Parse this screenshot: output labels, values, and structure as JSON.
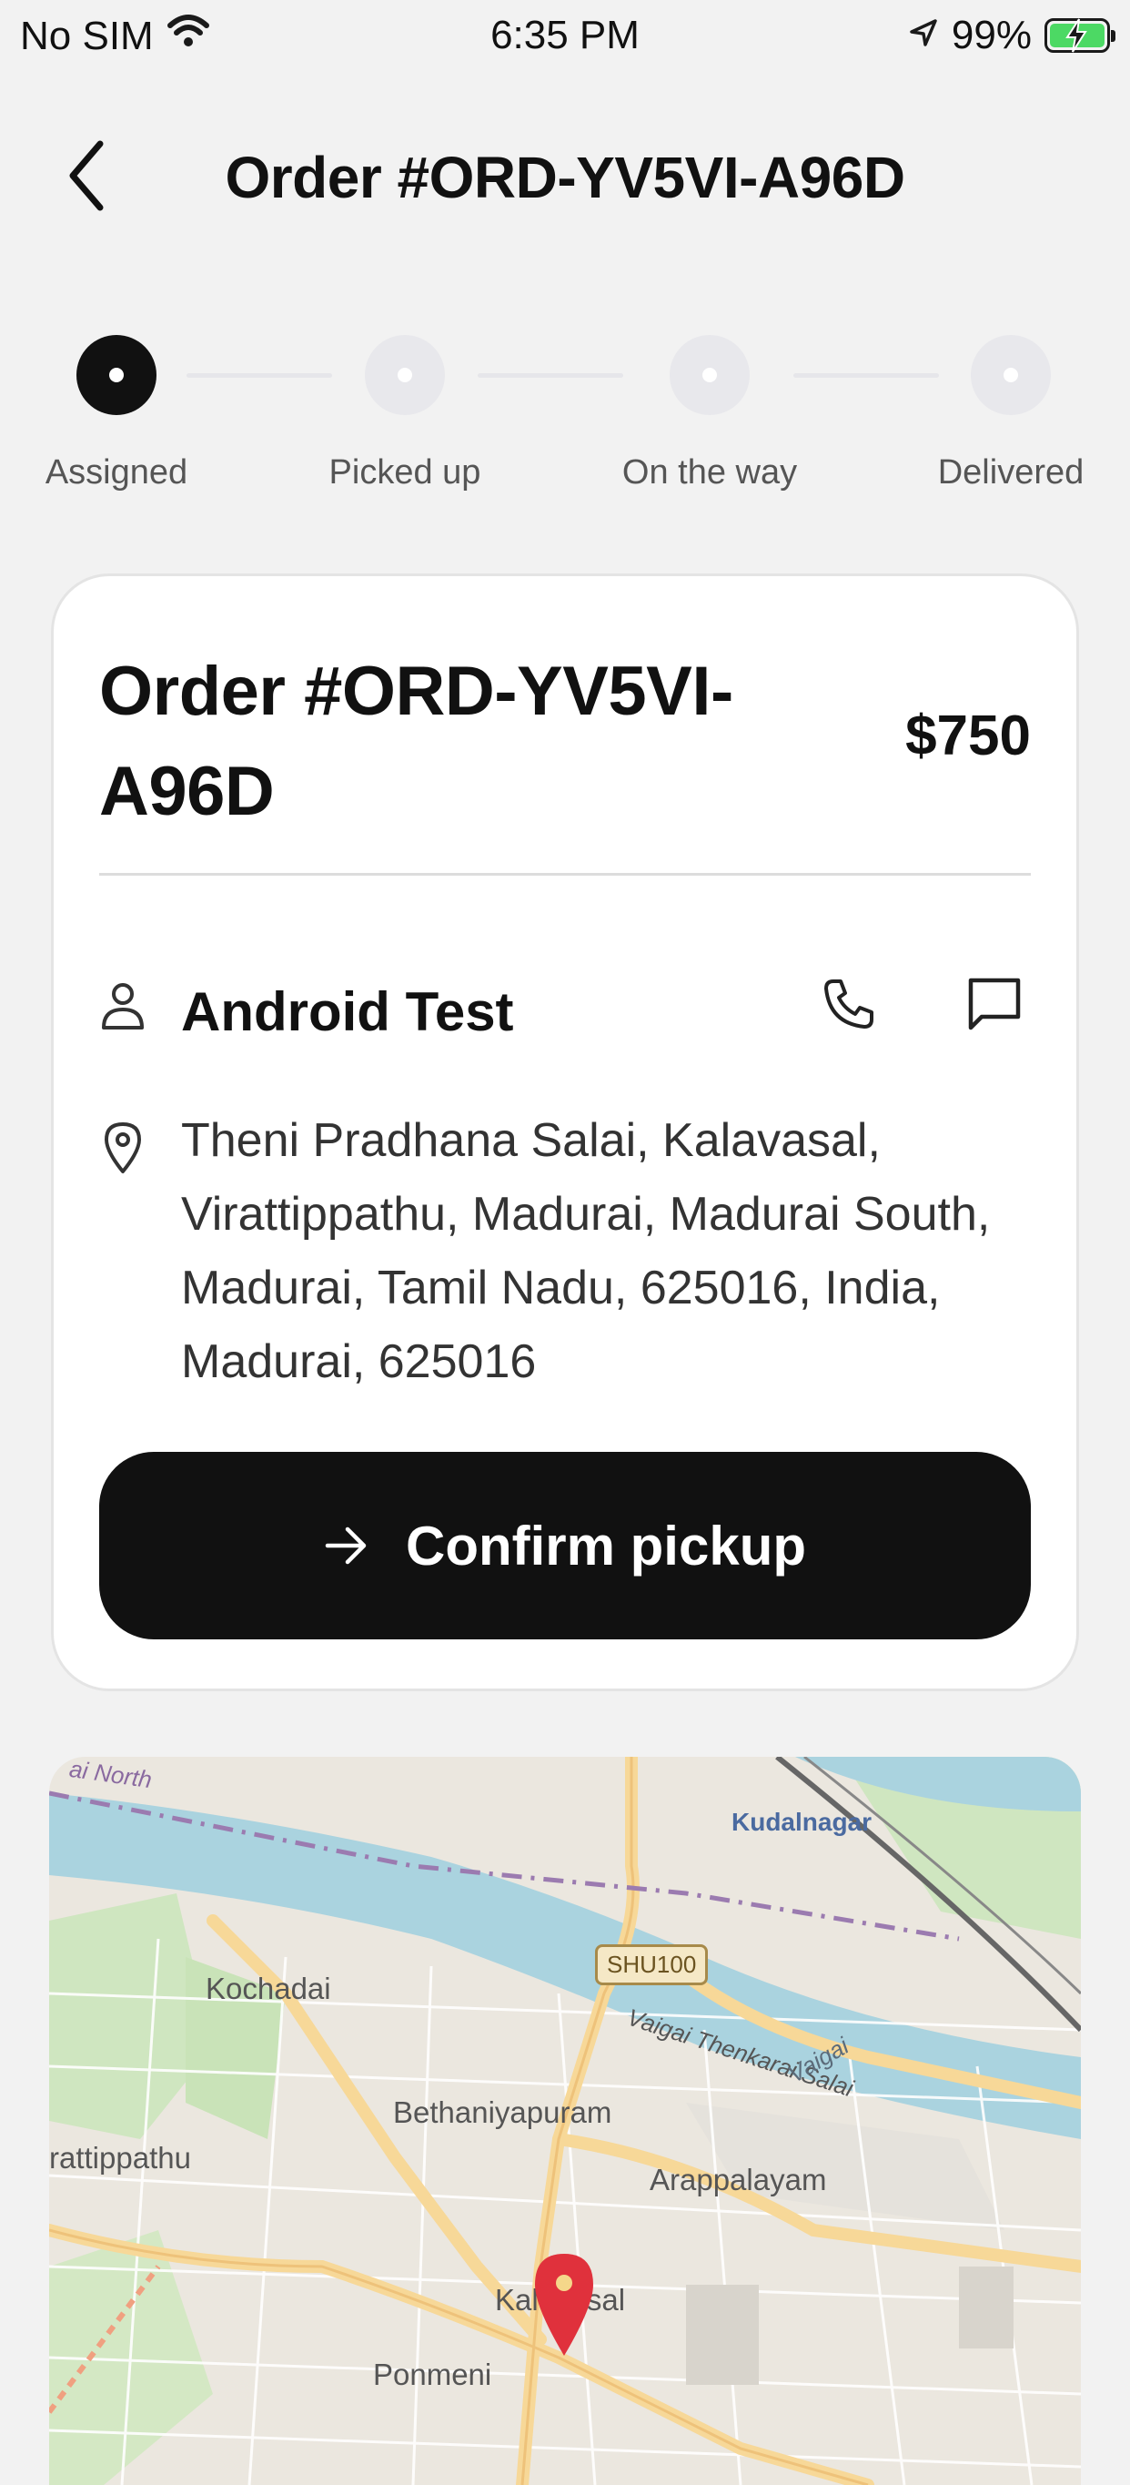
{
  "status_bar": {
    "carrier": "No SIM",
    "time": "6:35 PM",
    "battery": "99%"
  },
  "header": {
    "title": "Order #ORD-YV5VI-A96D"
  },
  "stepper": {
    "steps": [
      {
        "label": "Assigned",
        "active": true
      },
      {
        "label": "Picked up",
        "active": false
      },
      {
        "label": "On the way",
        "active": false
      },
      {
        "label": "Delivered",
        "active": false
      }
    ]
  },
  "order_card": {
    "title": "Order #ORD-YV5VI-A96D",
    "price": "$750",
    "customer_name": "Android Test",
    "address": "Theni Pradhana Salai, Kalavasal, Virattippathu, Madurai, Madurai South, Madurai, Tamil Nadu, 625016, India, Madurai, 625016",
    "confirm_label": "Confirm pickup"
  },
  "map": {
    "labels": {
      "kudalnagar": "Kudalnagar",
      "kochadai": "Kochadai",
      "bethaniyapuram": "Bethaniyapuram",
      "arappalayam": "Arappalayam",
      "virattippathu": "rattippathu",
      "kalavasal": "Kalavasal",
      "ponmeni": "Ponmeni",
      "vaigai_road": "Vaigai Thenkarai Salai",
      "vaigai_river": "Vaigai",
      "north": "ai North",
      "shield": "SHU100"
    }
  },
  "colors": {
    "accent": "#111111",
    "pin": "#e0313c",
    "battery": "#4cd964",
    "water": "#aad3df"
  }
}
